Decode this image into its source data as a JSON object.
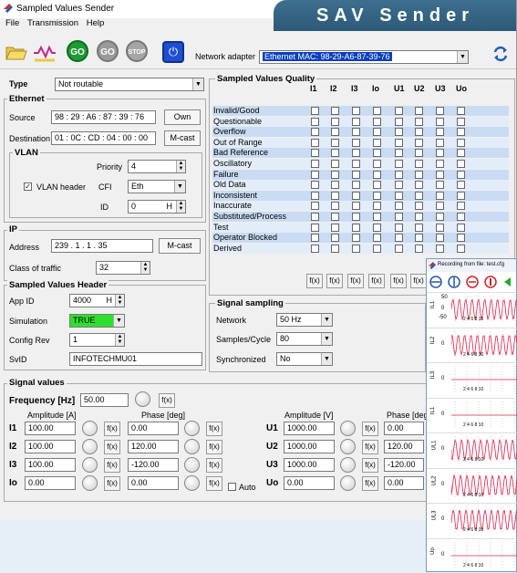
{
  "window": {
    "title": "Sampled Values Sender",
    "brand": "SAV Sender"
  },
  "menu": [
    "File",
    "Transmission",
    "Help"
  ],
  "toolbar": {
    "go_label": "GO",
    "go2_label": "GO",
    "stop_label": "STOP",
    "network_adapter_label": "Network adapter",
    "network_adapter_value": "Ethernet MAC: 98-29-A6-87-39-76"
  },
  "type_row": {
    "label": "Type",
    "value": "Not routable"
  },
  "ethernet": {
    "title": "Ethernet",
    "source_label": "Source",
    "source_value": "98 : 29 : A6 : 87 : 39 : 76",
    "own_label": "Own",
    "dest_label": "Destination",
    "dest_value": "01 : 0C : CD : 04 : 00 : 00",
    "mcast_label": "M-cast"
  },
  "vlan": {
    "title": "VLAN",
    "header_label": "VLAN header",
    "header_checked": true,
    "priority_label": "Priority",
    "priority_value": "4",
    "cfi_label": "CFI",
    "cfi_value": "Eth",
    "id_label": "ID",
    "id_value": "0",
    "id_suffix": "H"
  },
  "ip": {
    "title": "IP",
    "address_label": "Address",
    "address_value": "239 . 1 . 1 . 35",
    "mcast_label": "M-cast",
    "class_label": "Class of traffic",
    "class_value": "32"
  },
  "svheader": {
    "title": "Sampled Values Header",
    "appid_label": "App ID",
    "appid_value": "4000",
    "appid_suffix": "H",
    "sim_label": "Simulation",
    "sim_value": "TRUE",
    "confrev_label": "Config Rev",
    "confrev_value": "1",
    "svid_label": "SvID",
    "svid_value": "INFOTECHMU01"
  },
  "quality": {
    "title": "Sampled Values Quality",
    "columns": [
      "I1",
      "I2",
      "I3",
      "Io",
      "U1",
      "U2",
      "U3",
      "Uo"
    ],
    "rows": [
      "Invalid/Good",
      "Questionable",
      "Overflow",
      "Out of Range",
      "Bad Reference",
      "Oscillatory",
      "Failure",
      "Old Data",
      "Inconsistent",
      "Inaccurate",
      "Substituted/Process",
      "Test",
      "Operator Blocked",
      "Derived"
    ],
    "fx_label": "f(x)"
  },
  "sampling": {
    "title": "Signal sampling",
    "network_label": "Network",
    "network_value": "50 Hz",
    "spc_label": "Samples/Cycle",
    "spc_value": "80",
    "sync_label": "Synchronized",
    "sync_value": "No"
  },
  "signals": {
    "title": "Signal values",
    "freq_label": "Frequency [Hz]",
    "freq_value": "50.00",
    "amp_a_label": "Amplitude [A]",
    "phase_label": "Phase [deg]",
    "amp_v_label": "Amplitude [V]",
    "phase_v_label": "Phase [deg",
    "auto_label": "Auto",
    "current": [
      {
        "name": "I1",
        "amp": "100.00",
        "phase": "0.00"
      },
      {
        "name": "I2",
        "amp": "100.00",
        "phase": "120.00"
      },
      {
        "name": "I3",
        "amp": "100.00",
        "phase": "-120.00"
      },
      {
        "name": "Io",
        "amp": "0.00",
        "phase": "0.00"
      }
    ],
    "voltage": [
      {
        "name": "U1",
        "amp": "1000.00",
        "phase": "0.00"
      },
      {
        "name": "U2",
        "amp": "1000.00",
        "phase": "120.00"
      },
      {
        "name": "U3",
        "amp": "1000.00",
        "phase": "-120.00"
      },
      {
        "name": "Uo",
        "amp": "0.00",
        "phase": "0.00"
      }
    ]
  },
  "recording": {
    "title": "Recording from file: test.cfg",
    "channels": [
      "IL1",
      "IL2",
      "IL3",
      "IL1",
      "UL1",
      "UL2",
      "UL3",
      "Uo"
    ],
    "axis_ticks": "2  4  6  8  10",
    "scale_top": "50",
    "scale_zero": "0",
    "scale_bottom": "-50"
  }
}
